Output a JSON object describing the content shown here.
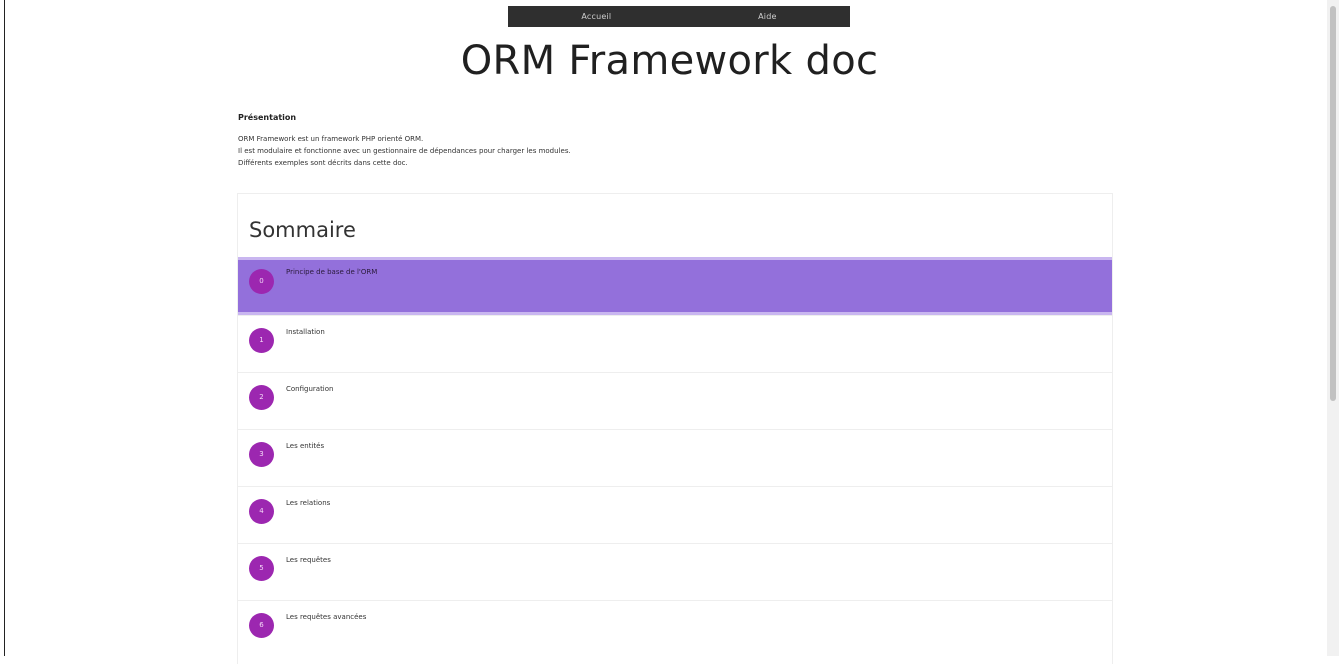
{
  "nav": {
    "items": [
      "Accueil",
      "Aide"
    ]
  },
  "page": {
    "title": "ORM Framework doc"
  },
  "intro": {
    "heading": "Présentation",
    "lines": [
      "ORM Framework est un framework PHP orienté ORM.",
      "Il est modulaire et fonctionne avec un gestionnaire de dépendances pour charger les modules.",
      "Différents exemples sont décrits dans cette doc."
    ]
  },
  "sommaire": {
    "title": "Sommaire",
    "items": [
      {
        "num": "0",
        "label": "Principe de base de l'ORM"
      },
      {
        "num": "1",
        "label": "Installation"
      },
      {
        "num": "2",
        "label": "Configuration"
      },
      {
        "num": "3",
        "label": "Les entités"
      },
      {
        "num": "4",
        "label": "Les relations"
      },
      {
        "num": "5",
        "label": "Les requêtes"
      },
      {
        "num": "6",
        "label": "Les requêtes avancées"
      }
    ]
  },
  "colors": {
    "active_item": "#9370db",
    "badge": "#9c27b0",
    "nav_bg": "#2f2f2f"
  }
}
